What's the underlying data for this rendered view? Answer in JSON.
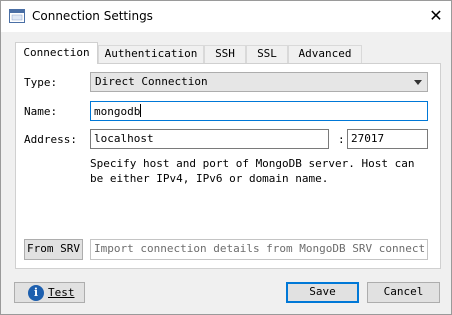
{
  "window": {
    "title": "Connection Settings"
  },
  "tabs": [
    {
      "label": "Connection"
    },
    {
      "label": "Authentication"
    },
    {
      "label": "SSH"
    },
    {
      "label": "SSL"
    },
    {
      "label": "Advanced"
    }
  ],
  "active_tab": "Connection",
  "form": {
    "type_label": "Type:",
    "type_value": "Direct Connection",
    "name_label": "Name:",
    "name_value": "mongodb",
    "address_label": "Address:",
    "host_value": "localhost",
    "port_separator": ":",
    "port_value": "27017",
    "help_text": "Specify host and port of MongoDB server. Host can be either IPv4, IPv6 or domain name."
  },
  "srv": {
    "button_label": "From SRV",
    "placeholder": "Import connection details from MongoDB SRV connection⋯"
  },
  "footer": {
    "test_label": "Test",
    "save_label": "Save",
    "cancel_label": "Cancel"
  }
}
